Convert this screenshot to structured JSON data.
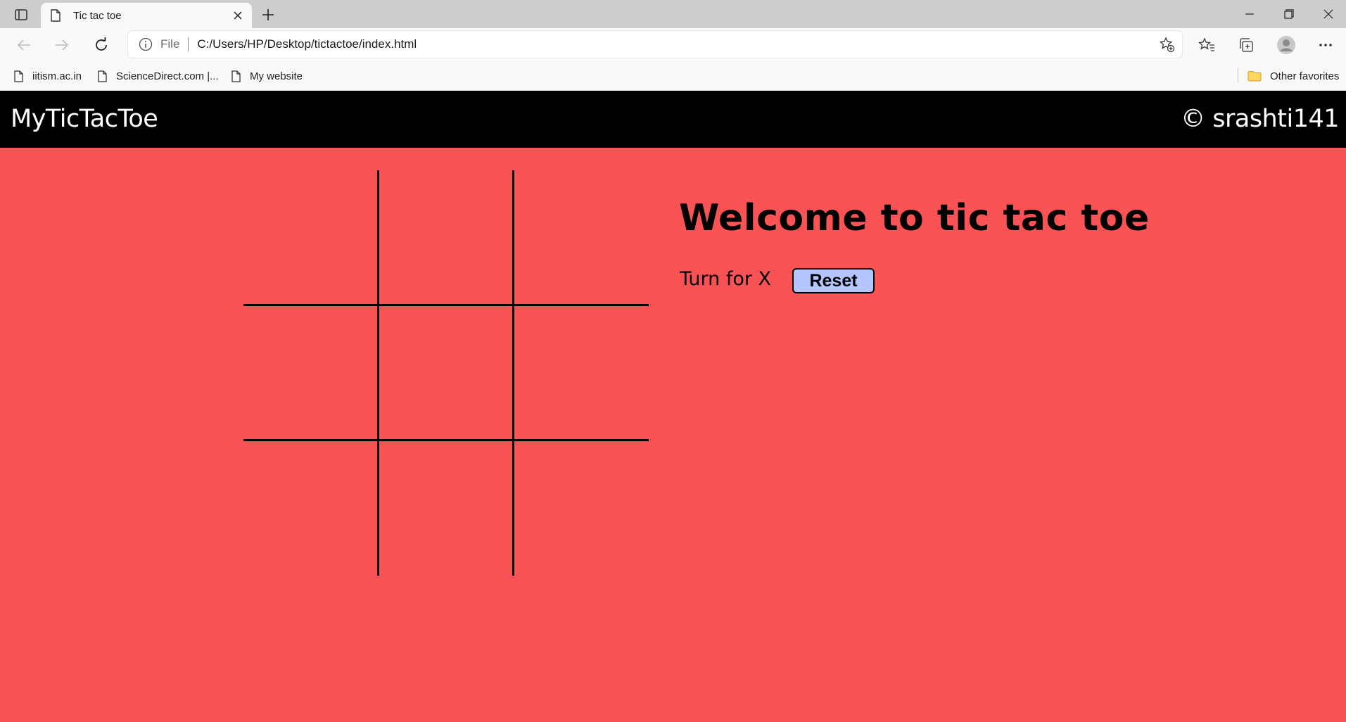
{
  "browser": {
    "tab": {
      "title": "Tic tac toe"
    },
    "omnibox": {
      "scheme": "File",
      "url": "C:/Users/HP/Desktop/tictactoe/index.html"
    },
    "bookmarks": [
      {
        "label": "iitism.ac.in"
      },
      {
        "label": "ScienceDirect.com |..."
      },
      {
        "label": "My website"
      }
    ],
    "other_favorites": "Other favorites"
  },
  "page": {
    "brand": "MyTicTacToe",
    "credit": "© srashti141",
    "heading": "Welcome to tic tac toe",
    "turn_text": "Turn for X",
    "reset_label": "Reset",
    "board": [
      "",
      "",
      "",
      "",
      "",
      "",
      "",
      "",
      ""
    ],
    "colors": {
      "background": "#f95356",
      "header": "#000000",
      "reset_button": "#b3c6ff"
    }
  },
  "icons": {
    "tab_actions": "tab-actions-icon",
    "page": "page-icon",
    "close": "close-icon",
    "new_tab": "plus-icon",
    "minimize": "minimize-icon",
    "restore": "restore-icon",
    "back": "back-arrow-icon",
    "forward": "forward-arrow-icon",
    "refresh": "refresh-icon",
    "info": "info-icon",
    "add_favorite": "star-plus-icon",
    "favorites": "favorites-icon",
    "collections": "collections-icon",
    "profile": "profile-icon",
    "menu": "more-icon",
    "folder": "folder-icon"
  }
}
